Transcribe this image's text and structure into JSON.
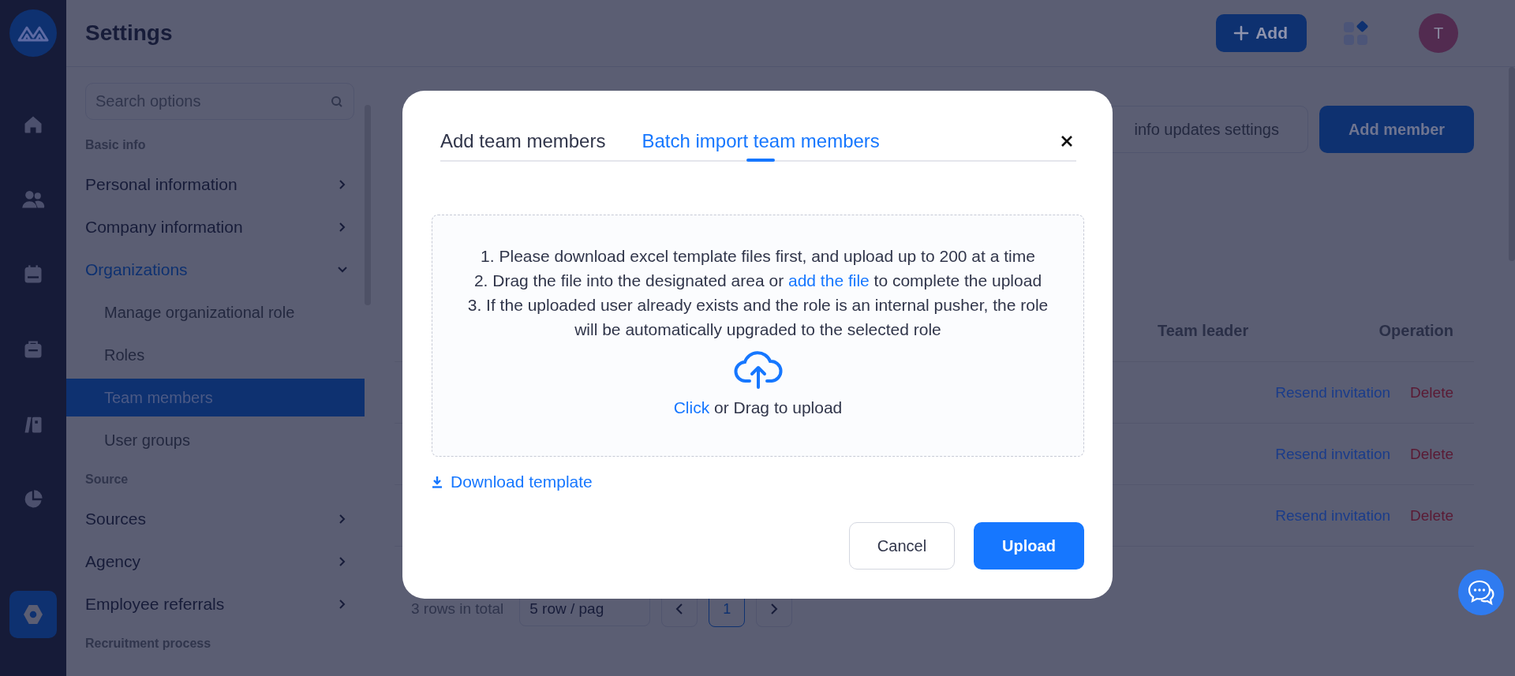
{
  "rail": {
    "items": [
      {
        "kind": "home",
        "selected": false
      },
      {
        "kind": "people",
        "selected": false
      },
      {
        "kind": "calendar",
        "selected": false
      },
      {
        "kind": "briefcase",
        "selected": false
      },
      {
        "kind": "book",
        "selected": false
      },
      {
        "kind": "pie",
        "selected": false
      },
      {
        "kind": "settings",
        "selected": true
      }
    ]
  },
  "header": {
    "title": "Settings",
    "add_button": "Add",
    "avatar": "T"
  },
  "nav": {
    "search_placeholder": "Search options",
    "sections": [
      {
        "heading": "Basic info",
        "items": [
          {
            "label": "Personal information",
            "selected": false,
            "expanded": false
          },
          {
            "label": "Company information",
            "selected": false,
            "expanded": false
          },
          {
            "label": "Organizations",
            "selected": true,
            "expanded": true,
            "children": [
              {
                "label": "Manage organizational role",
                "selected": false
              },
              {
                "label": "Roles",
                "selected": false
              },
              {
                "label": "Team members",
                "selected": true
              },
              {
                "label": "User groups",
                "selected": false
              }
            ]
          }
        ]
      },
      {
        "heading": "Source",
        "items": [
          {
            "label": "Sources",
            "selected": false,
            "expanded": false
          },
          {
            "label": "Agency",
            "selected": false,
            "expanded": false
          },
          {
            "label": "Employee referrals",
            "selected": false,
            "expanded": false
          }
        ]
      },
      {
        "heading": "Recruitment process"
      }
    ]
  },
  "main": {
    "toolbar_buttons": [
      {
        "label": "info updates settings",
        "kind": "outline"
      },
      {
        "label": "Add member",
        "kind": "primary"
      }
    ],
    "table": {
      "columns": [
        "Team leader",
        "Operation"
      ],
      "rows": [
        {
          "actions": [
            {
              "label": "Resend invitation",
              "kind": "link"
            },
            {
              "label": "Delete",
              "kind": "danger"
            }
          ]
        },
        {
          "actions": [
            {
              "label": "Resend invitation",
              "kind": "link"
            },
            {
              "label": "Delete",
              "kind": "danger"
            }
          ]
        },
        {
          "actions": [
            {
              "label": "Resend invitation",
              "kind": "link"
            },
            {
              "label": "Delete",
              "kind": "danger"
            }
          ]
        }
      ]
    },
    "pagination": {
      "total": "3 rows in total",
      "page_size": "5 row / pag",
      "pages": [
        {
          "label": "1",
          "selected": true
        }
      ]
    }
  },
  "modal": {
    "tabs": [
      {
        "label": "Add team members",
        "selected": false
      },
      {
        "label": "Batch import team members",
        "selected": true
      }
    ],
    "instructions": [
      {
        "text": "1. Please download excel template files first, and upload up to 200 at a time"
      },
      {
        "text": "2. Drag the file into the designated area or ",
        "link": "add the file",
        "after": " to complete the upload"
      },
      {
        "text": "3. If the uploaded user already exists and the role is an internal pusher, the role will be automatically upgraded to the selected role"
      }
    ],
    "upload_prompt": {
      "link": "Click",
      "text": " or Drag to upload"
    },
    "download_link": "Download template",
    "buttons": [
      {
        "label": "Cancel",
        "kind": "secondary"
      },
      {
        "label": "Upload",
        "kind": "primary"
      }
    ]
  }
}
